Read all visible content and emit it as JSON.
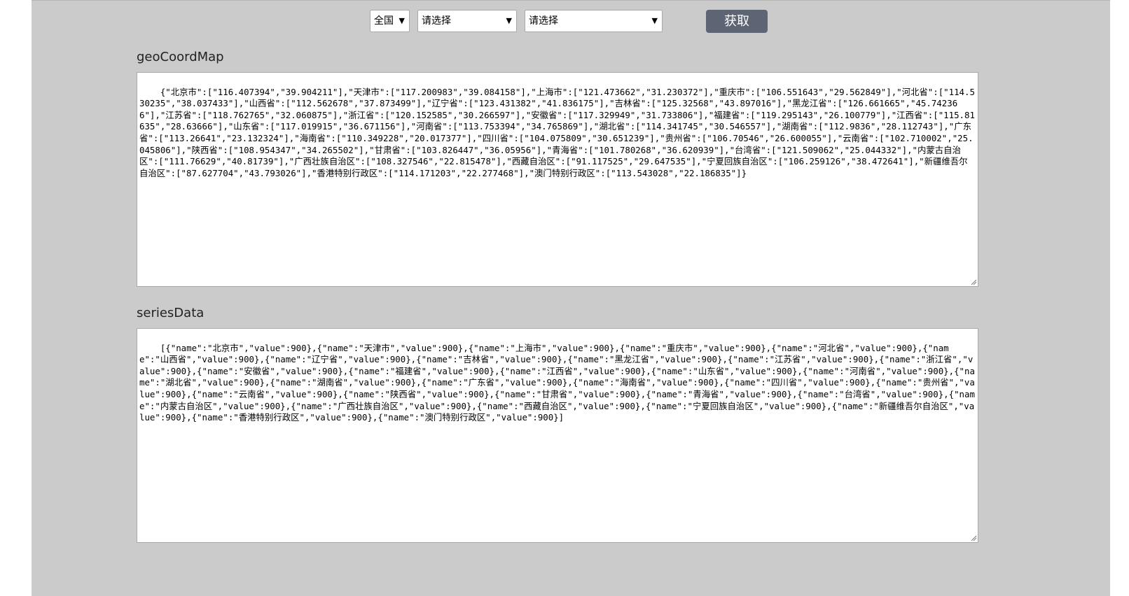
{
  "toolbar": {
    "region_select": "全国",
    "province_select": "请选择",
    "city_select": "请选择",
    "fetch_button": "获取"
  },
  "geo_section": {
    "label": "geoCoordMap",
    "content": "{\"北京市\":[\"116.407394\",\"39.904211\"],\"天津市\":[\"117.200983\",\"39.084158\"],\"上海市\":[\"121.473662\",\"31.230372\"],\"重庆市\":[\"106.551643\",\"29.562849\"],\"河北省\":[\"114.530235\",\"38.037433\"],\"山西省\":[\"112.562678\",\"37.873499\"],\"辽宁省\":[\"123.431382\",\"41.836175\"],\"吉林省\":[\"125.32568\",\"43.897016\"],\"黑龙江省\":[\"126.661665\",\"45.742366\"],\"江苏省\":[\"118.762765\",\"32.060875\"],\"浙江省\":[\"120.152585\",\"30.266597\"],\"安徽省\":[\"117.329949\",\"31.733806\"],\"福建省\":[\"119.295143\",\"26.100779\"],\"江西省\":[\"115.81635\",\"28.63666\"],\"山东省\":[\"117.019915\",\"36.671156\"],\"河南省\":[\"113.753394\",\"34.765869\"],\"湖北省\":[\"114.341745\",\"30.546557\"],\"湖南省\":[\"112.9836\",\"28.112743\"],\"广东省\":[\"113.26641\",\"23.132324\"],\"海南省\":[\"110.349228\",\"20.017377\"],\"四川省\":[\"104.075809\",\"30.651239\"],\"贵州省\":[\"106.70546\",\"26.600055\"],\"云南省\":[\"102.710002\",\"25.045806\"],\"陕西省\":[\"108.954347\",\"34.265502\"],\"甘肃省\":[\"103.826447\",\"36.05956\"],\"青海省\":[\"101.780268\",\"36.620939\"],\"台湾省\":[\"121.509062\",\"25.044332\"],\"内蒙古自治区\":[\"111.76629\",\"40.81739\"],\"广西壮族自治区\":[\"108.327546\",\"22.815478\"],\"西藏自治区\":[\"91.117525\",\"29.647535\"],\"宁夏回族自治区\":[\"106.259126\",\"38.472641\"],\"新疆维吾尔自治区\":[\"87.627704\",\"43.793026\"],\"香港特别行政区\":[\"114.171203\",\"22.277468\"],\"澳门特别行政区\":[\"113.543028\",\"22.186835\"]}"
  },
  "series_section": {
    "label": "seriesData",
    "content": "[{\"name\":\"北京市\",\"value\":900},{\"name\":\"天津市\",\"value\":900},{\"name\":\"上海市\",\"value\":900},{\"name\":\"重庆市\",\"value\":900},{\"name\":\"河北省\",\"value\":900},{\"name\":\"山西省\",\"value\":900},{\"name\":\"辽宁省\",\"value\":900},{\"name\":\"吉林省\",\"value\":900},{\"name\":\"黑龙江省\",\"value\":900},{\"name\":\"江苏省\",\"value\":900},{\"name\":\"浙江省\",\"value\":900},{\"name\":\"安徽省\",\"value\":900},{\"name\":\"福建省\",\"value\":900},{\"name\":\"江西省\",\"value\":900},{\"name\":\"山东省\",\"value\":900},{\"name\":\"河南省\",\"value\":900},{\"name\":\"湖北省\",\"value\":900},{\"name\":\"湖南省\",\"value\":900},{\"name\":\"广东省\",\"value\":900},{\"name\":\"海南省\",\"value\":900},{\"name\":\"四川省\",\"value\":900},{\"name\":\"贵州省\",\"value\":900},{\"name\":\"云南省\",\"value\":900},{\"name\":\"陕西省\",\"value\":900},{\"name\":\"甘肃省\",\"value\":900},{\"name\":\"青海省\",\"value\":900},{\"name\":\"台湾省\",\"value\":900},{\"name\":\"内蒙古自治区\",\"value\":900},{\"name\":\"广西壮族自治区\",\"value\":900},{\"name\":\"西藏自治区\",\"value\":900},{\"name\":\"宁夏回族自治区\",\"value\":900},{\"name\":\"新疆维吾尔自治区\",\"value\":900},{\"name\":\"香港特别行政区\",\"value\":900},{\"name\":\"澳门特别行政区\",\"value\":900}]"
  }
}
